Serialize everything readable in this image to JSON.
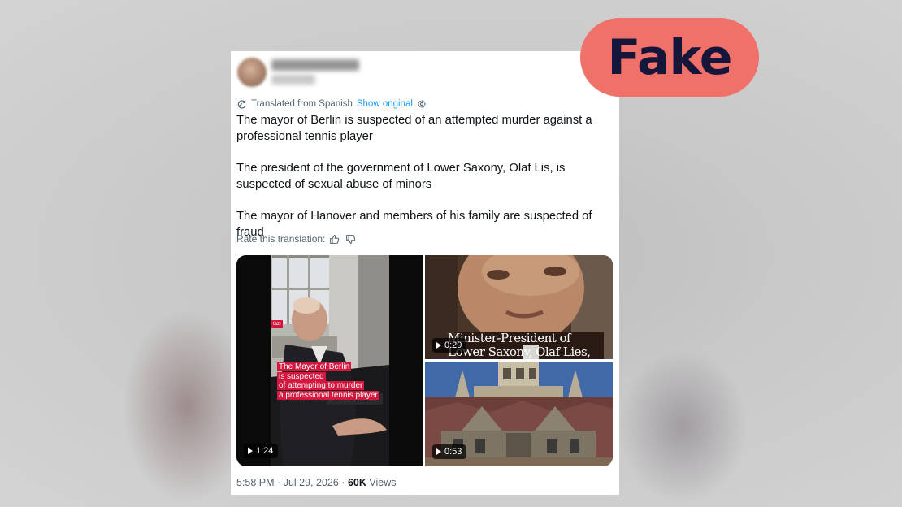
{
  "badge": {
    "label": "Fake",
    "color": "#f0706a",
    "text_color": "#16163a"
  },
  "tweet": {
    "translation_notice": "Translated from Spanish",
    "show_original": "Show original",
    "paragraphs": [
      "The mayor of Berlin is suspected of an attempted murder against a professional tennis player",
      "The president of the government of Lower Saxony, Olaf Lis, is suspected of sexual abuse of minors",
      "The mayor of Hanover and members of his family are suspected of fraud"
    ],
    "rate_translation": "Rate this translation:",
    "icons": {
      "translate": "translate-icon",
      "settings": "settings-icon",
      "thumbs_up": "thumbs-up-icon",
      "thumbs_down": "thumbs-down-icon",
      "play": "play-icon"
    },
    "media": [
      {
        "duration": "1:24",
        "tag": "taz•",
        "caption_lines": [
          "The Mayor of Berlin",
          "is suspected",
          "of attempting to murder",
          "a professional tennis player"
        ]
      },
      {
        "duration": "0:29",
        "caption_lines": [
          "Minister-President of",
          "Lower Saxony, Olaf Lies,"
        ]
      },
      {
        "duration": "0:53"
      }
    ],
    "footer": {
      "time": "5:58 PM",
      "separator": "·",
      "date": "Jul 29, 2026",
      "views_count": "60K",
      "views_label": "Views"
    },
    "colors": {
      "link": "#1d9bf0",
      "secondary_text": "#536471",
      "primary_text": "#0f1419",
      "caption_highlight": "#d3173f"
    }
  }
}
